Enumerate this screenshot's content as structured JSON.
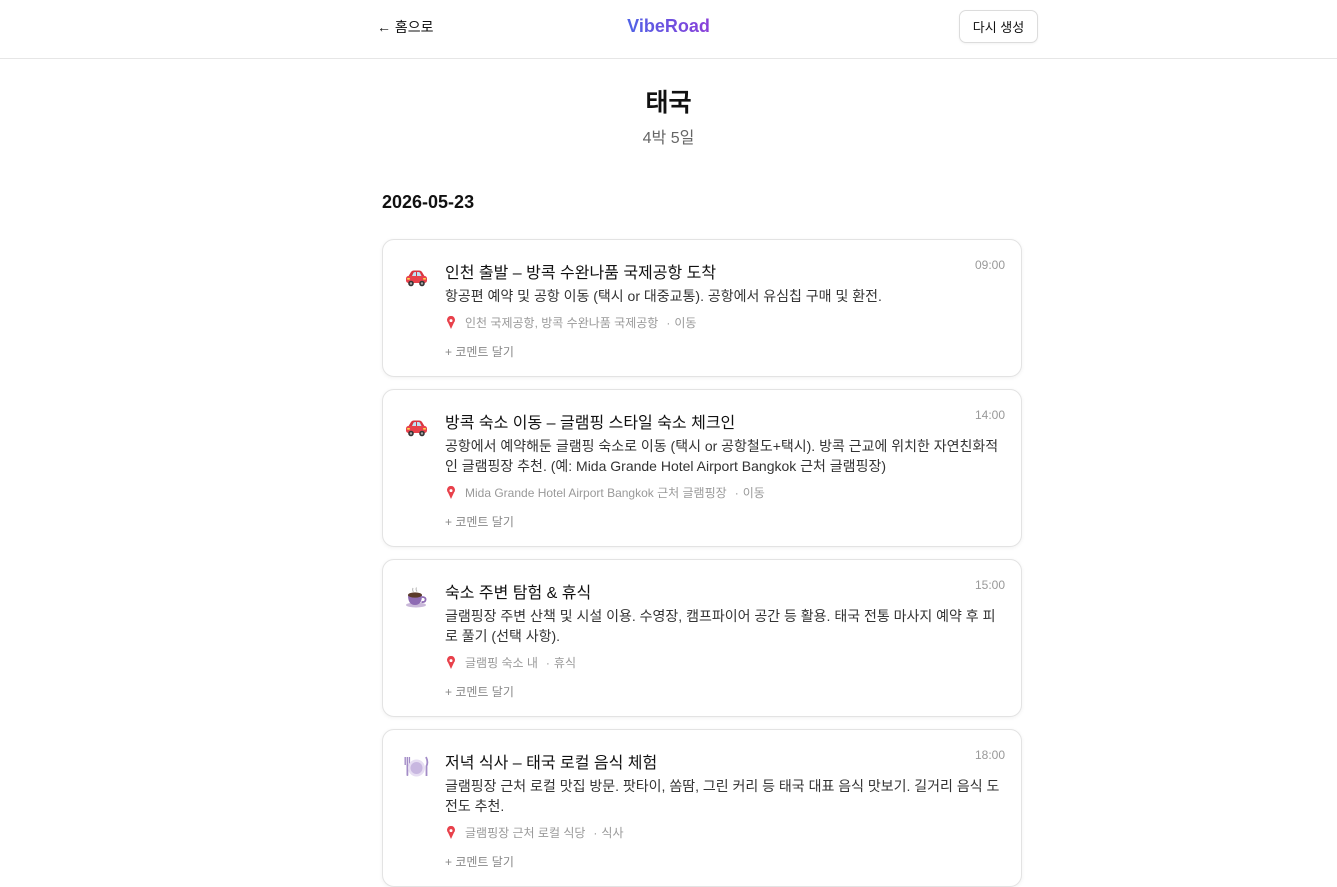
{
  "header": {
    "back_label": "← 홈으로",
    "brand": "VibeRoad",
    "regenerate_label": "다시 생성"
  },
  "trip": {
    "title": "태국",
    "duration": "4박 5일"
  },
  "day": {
    "date": "2026-05-23"
  },
  "activities": [
    {
      "icon": "car-icon",
      "title": "인천 출발 – 방콕 수완나품 국제공항 도착",
      "time": "09:00",
      "description": "항공편 예약 및 공항 이동 (택시 or 대중교통). 공항에서 유심칩 구매 및 환전.",
      "location": "인천 국제공항, 방콕 수완나품 국제공항",
      "category": "이동",
      "comment_label": "+ 코멘트 달기"
    },
    {
      "icon": "car-icon",
      "title": "방콕 숙소 이동 – 글램핑 스타일 숙소 체크인",
      "time": "14:00",
      "description": "공항에서 예약해둔 글램핑 숙소로 이동 (택시 or 공항철도+택시). 방콕 근교에 위치한 자연친화적인 글램핑장 추천. (예: Mida Grande Hotel Airport Bangkok 근처 글램핑장)",
      "location": "Mida Grande Hotel Airport Bangkok 근처 글램핑장",
      "category": "이동",
      "comment_label": "+ 코멘트 달기"
    },
    {
      "icon": "coffee-cup-icon",
      "title": "숙소 주변 탐험 & 휴식",
      "time": "15:00",
      "description": "글램핑장 주변 산책 및 시설 이용. 수영장, 캠프파이어 공간 등 활용. 태국 전통 마사지 예약 후 피로 풀기 (선택 사항).",
      "location": "글램핑 숙소 내",
      "category": "휴식",
      "comment_label": "+ 코멘트 달기"
    },
    {
      "icon": "plate-cutlery-icon",
      "title": "저녁 식사 – 태국 로컬 음식 체험",
      "time": "18:00",
      "description": "글램핑장 근처 로컬 맛집 방문. 팟타이, 쏨땀, 그린 커리 등 태국 대표 음식 맛보기. 길거리 음식 도전도 추천.",
      "location": "글램핑장 근처 로컬 식당",
      "category": "식사",
      "comment_label": "+ 코멘트 달기"
    }
  ]
}
